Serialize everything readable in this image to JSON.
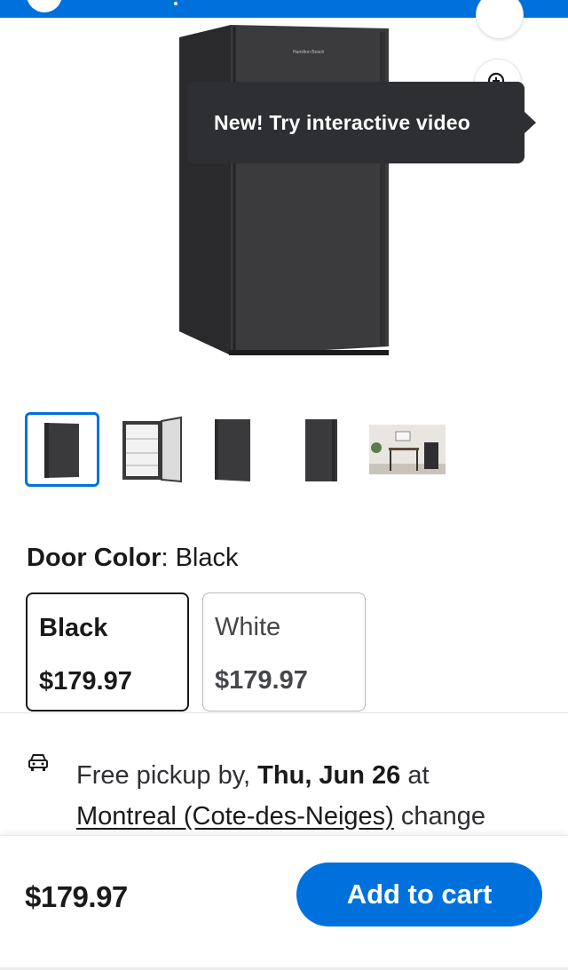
{
  "product": {
    "brand_on_appliance": "Hamilton Beach",
    "tooltip_text": "New! Try interactive video",
    "thumbnails": [
      {
        "name": "thumbnail-front-view",
        "selected": true
      },
      {
        "name": "thumbnail-open-door",
        "selected": false
      },
      {
        "name": "thumbnail-angle-view",
        "selected": false
      },
      {
        "name": "thumbnail-side-view",
        "selected": false
      },
      {
        "name": "thumbnail-lifestyle",
        "selected": false
      }
    ]
  },
  "variants": {
    "label": "Door Color",
    "selected_value": "Black",
    "options": [
      {
        "name": "Black",
        "price": "$179.97",
        "selected": true
      },
      {
        "name": "White",
        "price": "$179.97",
        "selected": false
      }
    ]
  },
  "fulfillment": {
    "prefix": "Free pickup by,",
    "date": "Thu, Jun 26",
    "at": "at",
    "store": "Montreal (Cote-des-Neiges)",
    "change": "change"
  },
  "cart_bar": {
    "price": "$179.97",
    "add_label": "Add to cart"
  },
  "colors": {
    "brand_blue": "#0071dc",
    "tooltip_bg": "#2e2f32"
  }
}
